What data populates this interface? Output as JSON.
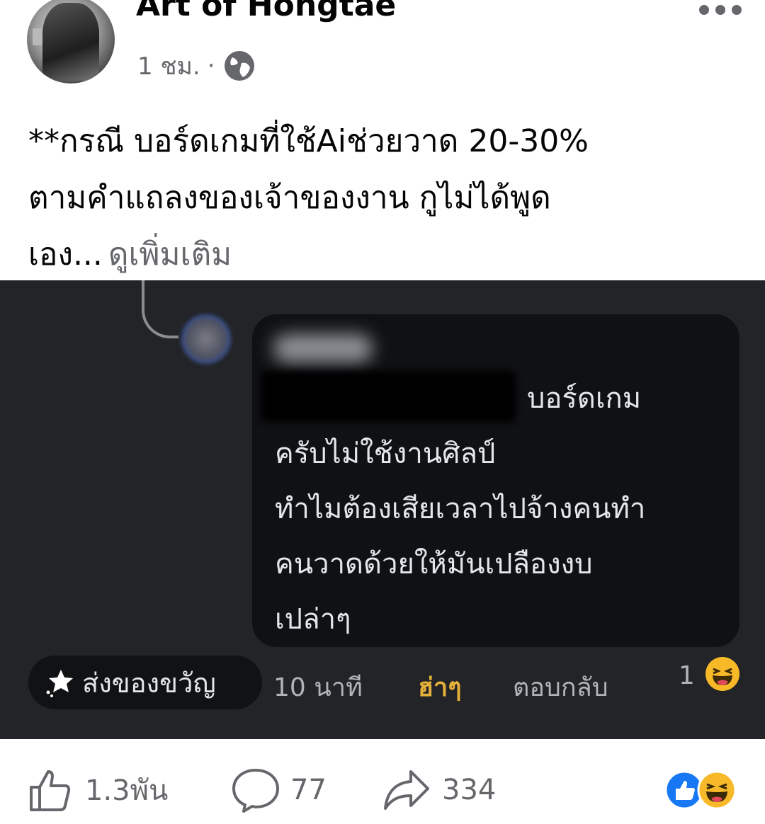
{
  "post": {
    "author": "Art of Hongtae",
    "time": "1 ชม.",
    "separator": "·",
    "privacy_icon": "globe-icon",
    "more_icon": "more-horizontal-icon",
    "text_lines": [
      "**กรณี บอร์ดเกมที่ใช้Aiช่วยวาด 20-30%",
      "ตามคำแถลงของเจ้าของงาน กูไม่ได้พูด",
      "เอง..."
    ],
    "see_more": "ดูเพิ่มเติม"
  },
  "screenshot": {
    "comment_lines": [
      "บอร์ดเกม",
      "ครับไม่ใช้งานศิลป์",
      "ทำไมต้องเสียเวลาไปจ้างคนทำ",
      "คนวาดด้วยให้มันเปลืองงบ",
      "เปล่าๆ"
    ],
    "gift_label": "ส่งของขวัญ",
    "time": "10 นาที",
    "reaction_label": "ฮ่าๆ",
    "reply_label": "ตอบกลับ",
    "reaction_count": "1",
    "colors": {
      "background": "#232427",
      "bubble": "#101114",
      "reaction_text": "#e5b13b"
    }
  },
  "footer": {
    "likes": "1.3พัน",
    "comments": "77",
    "shares": "334",
    "reaction_icons": [
      "like-reaction-icon",
      "haha-reaction-icon"
    ]
  }
}
